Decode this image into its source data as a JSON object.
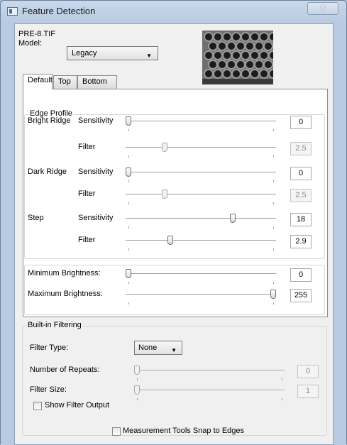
{
  "window": {
    "title": "Feature Detection",
    "close_label": "X"
  },
  "file": {
    "name": "PRE-8.TIF"
  },
  "model": {
    "label": "Model:",
    "value": "Legacy"
  },
  "tabs": [
    {
      "label": "Default"
    },
    {
      "label": "Top"
    },
    {
      "label": "Bottom"
    }
  ],
  "edge_profile": {
    "title": "Edge Profile",
    "rows": [
      {
        "group": "Bright Ridge",
        "label": "Sensitivity",
        "value": "0",
        "level": 0.0,
        "disabled": false
      },
      {
        "group": "",
        "label": "Filter",
        "value": "2.5",
        "level": 0.25,
        "disabled": true
      },
      {
        "group": "Dark Ridge",
        "label": "Sensitivity",
        "value": "0",
        "level": 0.0,
        "disabled": false
      },
      {
        "group": "",
        "label": "Filter",
        "value": "2.5",
        "level": 0.25,
        "disabled": true
      },
      {
        "group": "Step",
        "label": "Sensitivity",
        "value": "18",
        "level": 0.72,
        "disabled": false
      },
      {
        "group": "",
        "label": "Filter",
        "value": "2.9",
        "level": 0.29,
        "disabled": false
      }
    ]
  },
  "brightness": {
    "rows": [
      {
        "label": "Minimum Brightness:",
        "value": "0",
        "level": 0.0,
        "disabled": false
      },
      {
        "label": "Maximum Brightness:",
        "value": "255",
        "level": 1.0,
        "disabled": false
      }
    ]
  },
  "filtering": {
    "title": "Built-in Filtering",
    "filter_type": {
      "label": "Filter Type:",
      "value": "None"
    },
    "rows": [
      {
        "label": "Number of Repeats:",
        "value": "0",
        "level": 0.0,
        "disabled": true
      },
      {
        "label": "Filter Size:",
        "value": "1",
        "level": 0.0,
        "disabled": true
      }
    ],
    "show_output": {
      "label": "Show Filter Output",
      "checked": false
    }
  },
  "snap": {
    "label": "Measurement Tools Snap to Edges",
    "checked": false
  }
}
